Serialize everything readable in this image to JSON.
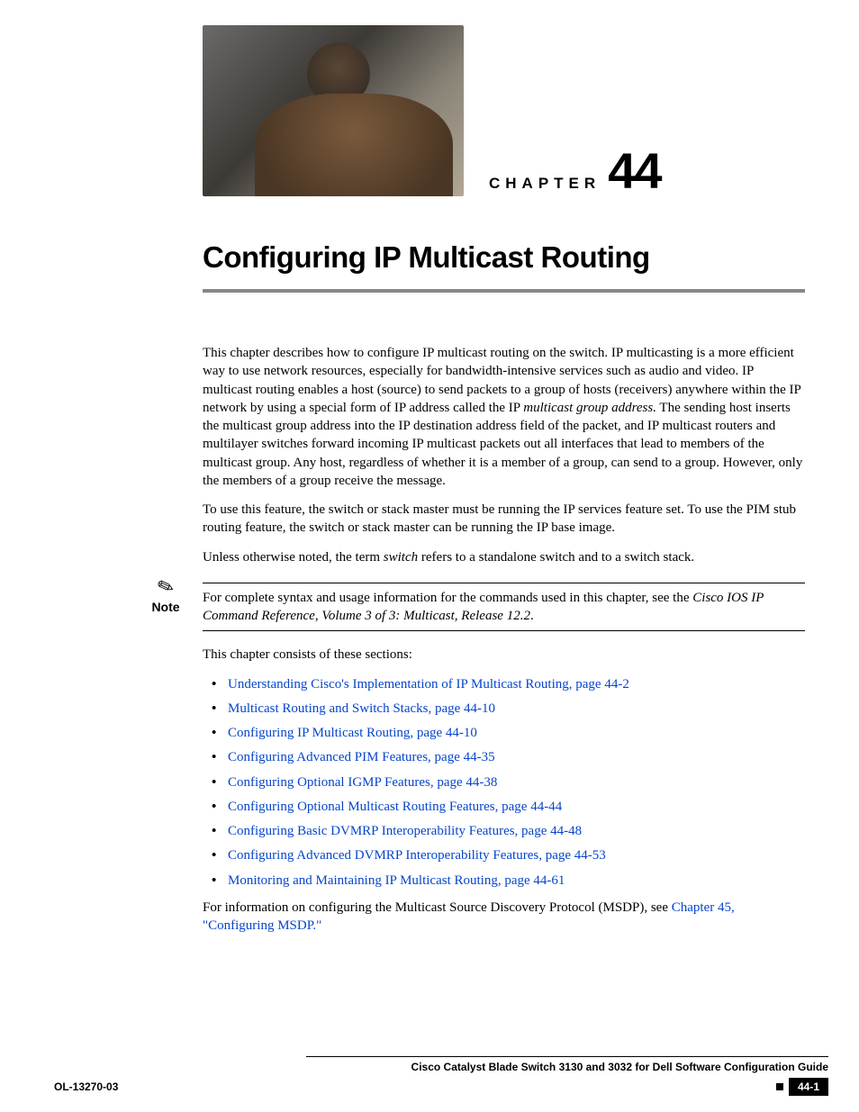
{
  "chapter": {
    "label_word": "CHAPTER",
    "number": "44"
  },
  "title": "Configuring IP Multicast Routing",
  "paragraphs": {
    "p1_a": "This chapter describes how to configure IP multicast routing on the switch. IP multicasting is a more efficient way to use network resources, especially for bandwidth-intensive services such as audio and video. IP multicast routing enables a host (source) to send packets to a group of hosts (receivers) anywhere within the IP network by using a special form of IP address called the IP ",
    "p1_i": "multicast group address.",
    "p1_b": " The sending host inserts the multicast group address into the IP destination address field of the packet, and IP multicast routers and multilayer switches forward incoming IP multicast packets out all interfaces that lead to members of the multicast group. Any host, regardless of whether it is a member of a group, can send to a group. However, only the members of a group receive the message.",
    "p2": "To use this feature, the switch or stack master must be running the IP services feature set. To use the PIM stub routing feature, the switch or stack master can be running the IP base image.",
    "p3_a": "Unless otherwise noted, the term ",
    "p3_i": "switch",
    "p3_b": " refers to a standalone switch and to a switch stack.",
    "note_a": "For complete syntax and usage information for the commands used in this chapter, see the ",
    "note_i": "Cisco IOS IP Command Reference, Volume 3 of 3: Multicast, Release 12.2",
    "note_b": ".",
    "p4": "This chapter consists of these sections:",
    "p5_a": "For information on configuring the Multicast Source Discovery Protocol (MSDP), see ",
    "p5_link": "Chapter 45, \"Configuring MSDP.\""
  },
  "note_label": "Note",
  "sections": [
    "Understanding Cisco's Implementation of IP Multicast Routing, page 44-2",
    "Multicast Routing and Switch Stacks, page 44-10",
    "Configuring IP Multicast Routing, page 44-10",
    "Configuring Advanced PIM Features, page 44-35",
    "Configuring Optional IGMP Features, page 44-38",
    "Configuring Optional Multicast Routing Features, page 44-44",
    "Configuring Basic DVMRP Interoperability Features, page 44-48",
    "Configuring Advanced DVMRP Interoperability Features, page 44-53",
    "Monitoring and Maintaining IP Multicast Routing, page 44-61"
  ],
  "footer": {
    "guide": "Cisco Catalyst Blade Switch 3130 and 3032 for Dell Software Configuration Guide",
    "doc_id": "OL-13270-03",
    "page_num": "44-1"
  }
}
